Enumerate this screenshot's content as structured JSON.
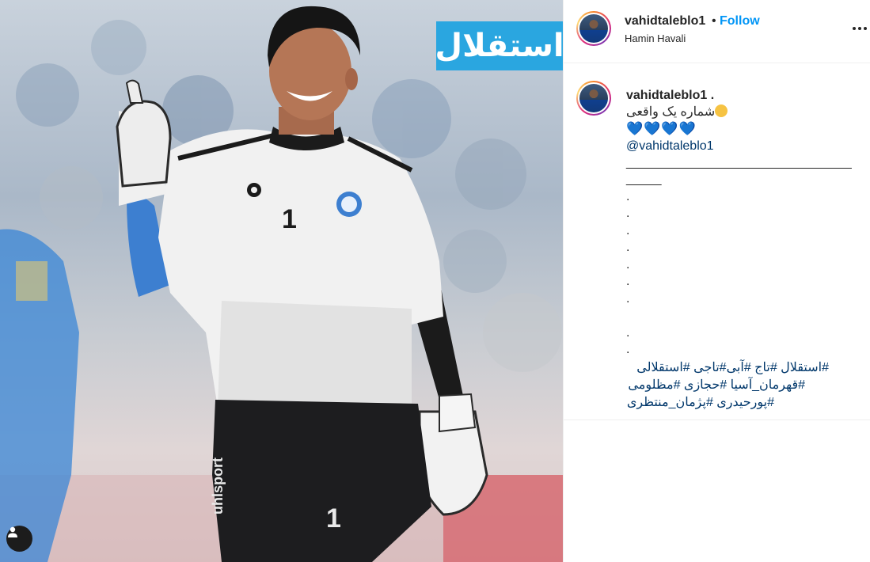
{
  "post": {
    "username": "vahidtaleblo1",
    "separator": "•",
    "follow_label": "Follow",
    "location": "Hamin Havali"
  },
  "image": {
    "brand_text": "استقلال",
    "jersey_number": "1",
    "shorts_brand": "uhlsport",
    "shorts_number": "1"
  },
  "caption": {
    "username": "vahidtaleblo1 .",
    "title_text": "شماره یک واقعی",
    "emoji_name": "wink-emoji",
    "hearts": "💙💙💙💙",
    "mention": "@vahidtaleblo1",
    "rule_line": "________________________________",
    "rule_tail": "_____",
    "dots": [
      ".",
      ".",
      ".",
      ".",
      ".",
      ".",
      ".",
      ".",
      "."
    ],
    "hashtags_line1": "#استقلال #تاج #آبی#تاجی #استقلالی",
    "hashtags_line2": "#قهرمان_آسیا #حجازی #مظلومی",
    "hashtags_line3": "#پورحیدری #پژمان_منتظری"
  },
  "icons": {
    "tag": "user-tag-icon",
    "more": "more-options-icon"
  }
}
